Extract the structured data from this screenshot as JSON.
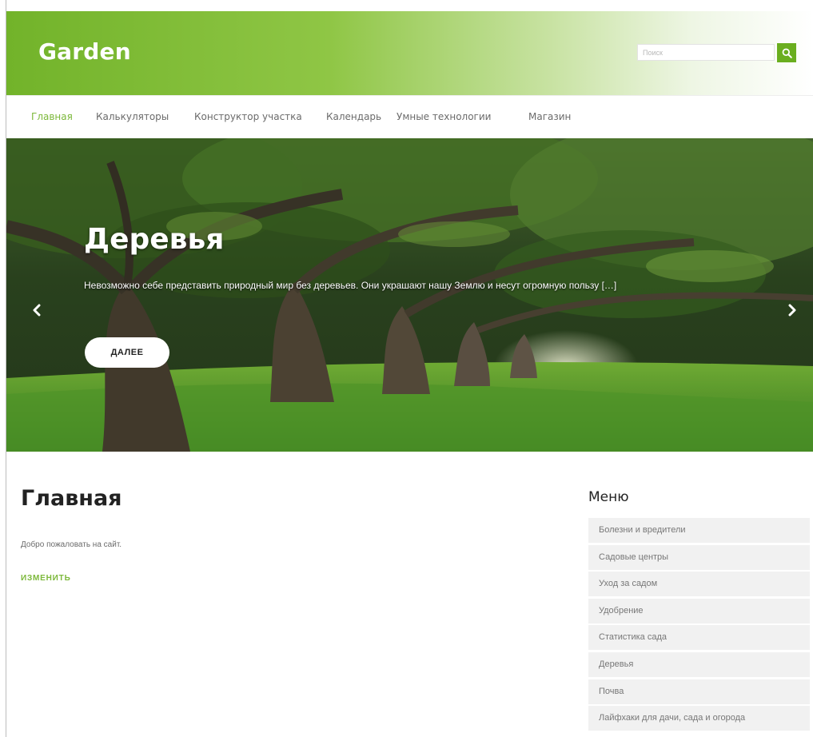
{
  "site": {
    "title": "Garden"
  },
  "search": {
    "placeholder": "Поиск"
  },
  "nav": {
    "items": [
      {
        "label": "Главная"
      },
      {
        "label": "Калькуляторы"
      },
      {
        "label": "Конструктор участка"
      },
      {
        "label": "Календарь"
      },
      {
        "label": "Умные технологии"
      },
      {
        "label": "Магазин"
      }
    ]
  },
  "slider": {
    "title": "Деревья",
    "excerpt": "Невозможно себе представить природный мир без деревьев. Они украшают нашу Землю и несут огромную пользу […]",
    "button": "ДАЛЕЕ"
  },
  "page": {
    "title": "Главная",
    "text": "Добро пожаловать на сайт.",
    "edit": "ИЗМЕНИТЬ"
  },
  "sidebar": {
    "title": "Меню",
    "items": [
      {
        "label": "Болезни и вредители"
      },
      {
        "label": "Садовые центры"
      },
      {
        "label": "Уход за садом"
      },
      {
        "label": "Удобрение"
      },
      {
        "label": "Статистика сада"
      },
      {
        "label": "Деревья"
      },
      {
        "label": "Почва"
      },
      {
        "label": "Лайфхаки для дачи, сада и огорода"
      }
    ]
  },
  "colors": {
    "accent": "#7cb83a",
    "header_start": "#72b32a",
    "search_button": "#6aae1f"
  },
  "icons": {
    "search": "search-icon",
    "prev": "chevron-left-icon",
    "next": "chevron-right-icon"
  }
}
